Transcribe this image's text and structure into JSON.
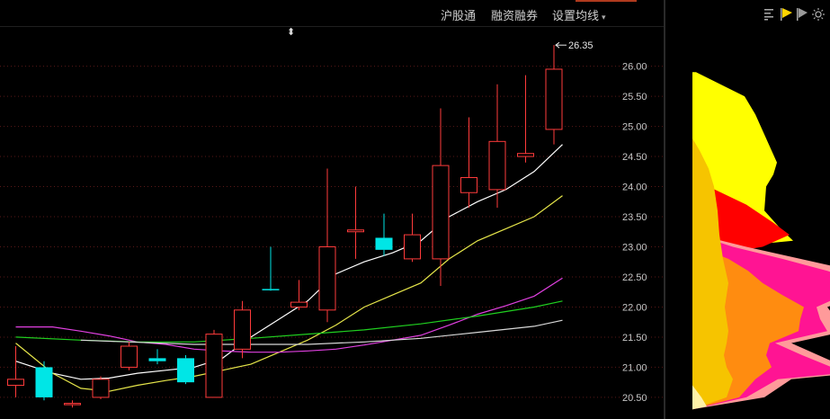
{
  "toolbar": {
    "hgt_label": "沪股通",
    "margin_label": "融资融券",
    "ma_label": "设置均线",
    "caret": "▾",
    "resize_glyph": "⬍"
  },
  "colors": {
    "up": "#ff3b3b",
    "down": "#00e6e6",
    "ma5": "#ffffff",
    "ma10": "#e6e64a",
    "ma20": "#e040e0",
    "ma30": "#20d020",
    "ma60": "#d8d8d8",
    "price_axis": "#c8c8c8",
    "grid": "#5a1818"
  },
  "chart_data": {
    "type": "candlestick",
    "max_label": "26.35",
    "ylim": [
      20.2,
      26.95
    ],
    "y_ticks": [
      "20.50",
      "21.00",
      "21.50",
      "22.00",
      "22.50",
      "23.00",
      "23.50",
      "24.00",
      "24.50",
      "25.00",
      "25.50",
      "26.00"
    ],
    "candles": [
      {
        "o": 20.7,
        "h": 21.35,
        "l": 20.5,
        "c": 20.8
      },
      {
        "o": 21.0,
        "h": 21.1,
        "l": 20.45,
        "c": 20.5
      },
      {
        "o": 20.38,
        "h": 20.45,
        "l": 20.33,
        "c": 20.4
      },
      {
        "o": 20.5,
        "h": 20.85,
        "l": 20.47,
        "c": 20.8
      },
      {
        "o": 21.0,
        "h": 21.42,
        "l": 20.95,
        "c": 21.35
      },
      {
        "o": 21.15,
        "h": 21.3,
        "l": 21.05,
        "c": 21.1
      },
      {
        "o": 21.15,
        "h": 21.2,
        "l": 20.72,
        "c": 20.75
      },
      {
        "o": 20.5,
        "h": 21.62,
        "l": 20.5,
        "c": 21.55
      },
      {
        "o": 21.3,
        "h": 22.1,
        "l": 21.15,
        "c": 21.95
      },
      {
        "o": 22.3,
        "h": 23.0,
        "l": 22.27,
        "c": 22.28
      },
      {
        "o": 22.0,
        "h": 22.45,
        "l": 21.95,
        "c": 22.08
      },
      {
        "o": 21.95,
        "h": 24.3,
        "l": 21.75,
        "c": 23.0
      },
      {
        "o": 23.25,
        "h": 24.0,
        "l": 22.8,
        "c": 23.28
      },
      {
        "o": 23.15,
        "h": 23.55,
        "l": 22.85,
        "c": 22.95
      },
      {
        "o": 22.8,
        "h": 23.55,
        "l": 22.75,
        "c": 23.2
      },
      {
        "o": 22.8,
        "h": 25.3,
        "l": 22.35,
        "c": 24.35
      },
      {
        "o": 23.9,
        "h": 25.15,
        "l": 23.65,
        "c": 24.15
      },
      {
        "o": 23.95,
        "h": 25.7,
        "l": 23.65,
        "c": 24.75
      },
      {
        "o": 24.5,
        "h": 25.85,
        "l": 24.4,
        "c": 24.55
      },
      {
        "o": 24.95,
        "h": 26.35,
        "l": 24.7,
        "c": 25.95
      }
    ],
    "ma_lines": [
      {
        "key": "ma5",
        "values": [
          [
            0,
            21.1
          ],
          [
            1.3,
            20.9
          ],
          [
            2.3,
            20.8
          ],
          [
            3.3,
            20.82
          ],
          [
            4.3,
            20.9
          ],
          [
            5.3,
            20.95
          ],
          [
            6.3,
            21.0
          ],
          [
            7.3,
            21.15
          ],
          [
            8.3,
            21.5
          ],
          [
            9.3,
            21.8
          ],
          [
            10.3,
            22.1
          ],
          [
            11.3,
            22.55
          ],
          [
            12.3,
            22.75
          ],
          [
            13.3,
            22.9
          ],
          [
            14.3,
            23.1
          ],
          [
            15.3,
            23.5
          ],
          [
            16.3,
            23.75
          ],
          [
            17.3,
            23.95
          ],
          [
            18.3,
            24.25
          ],
          [
            19.3,
            24.7
          ]
        ]
      },
      {
        "key": "ma10",
        "values": [
          [
            0,
            21.4
          ],
          [
            1.3,
            20.9
          ],
          [
            2.3,
            20.65
          ],
          [
            3.3,
            20.6
          ],
          [
            4.3,
            20.7
          ],
          [
            5.3,
            20.78
          ],
          [
            6.3,
            20.85
          ],
          [
            7.3,
            20.95
          ],
          [
            8.3,
            21.05
          ],
          [
            9.3,
            21.25
          ],
          [
            10.3,
            21.45
          ],
          [
            11.3,
            21.7
          ],
          [
            12.3,
            22.0
          ],
          [
            13.3,
            22.2
          ],
          [
            14.3,
            22.4
          ],
          [
            15.3,
            22.8
          ],
          [
            16.3,
            23.1
          ],
          [
            17.3,
            23.3
          ],
          [
            18.3,
            23.5
          ],
          [
            19.3,
            23.85
          ]
        ]
      },
      {
        "key": "ma20",
        "values": [
          [
            0,
            21.67
          ],
          [
            1.3,
            21.67
          ],
          [
            2.3,
            21.6
          ],
          [
            3.3,
            21.52
          ],
          [
            4.3,
            21.42
          ],
          [
            5.3,
            21.38
          ],
          [
            6.3,
            21.3
          ],
          [
            7.3,
            21.27
          ],
          [
            8.3,
            21.25
          ],
          [
            9.3,
            21.25
          ],
          [
            10.3,
            21.27
          ],
          [
            11.3,
            21.3
          ],
          [
            12.3,
            21.37
          ],
          [
            13.3,
            21.45
          ],
          [
            14.3,
            21.53
          ],
          [
            15.3,
            21.7
          ],
          [
            16.3,
            21.88
          ],
          [
            17.3,
            22.02
          ],
          [
            18.3,
            22.18
          ],
          [
            19.3,
            22.48
          ]
        ]
      },
      {
        "key": "ma30",
        "values": [
          [
            0,
            21.5
          ],
          [
            2.3,
            21.45
          ],
          [
            4.3,
            21.42
          ],
          [
            6.3,
            21.42
          ],
          [
            8.3,
            21.48
          ],
          [
            10.3,
            21.55
          ],
          [
            12.3,
            21.62
          ],
          [
            14.3,
            21.72
          ],
          [
            16.3,
            21.85
          ],
          [
            18.3,
            22.0
          ],
          [
            19.3,
            22.1
          ]
        ]
      },
      {
        "key": "ma60",
        "values": [
          [
            2.3,
            21.45
          ],
          [
            6.3,
            21.38
          ],
          [
            10.3,
            21.38
          ],
          [
            12.3,
            21.42
          ],
          [
            14.3,
            21.48
          ],
          [
            16.3,
            21.58
          ],
          [
            18.3,
            21.68
          ],
          [
            19.3,
            21.78
          ]
        ]
      }
    ]
  },
  "chip_profile": {
    "base": 30,
    "layers": [
      {
        "name": "chips-yellow",
        "color": "#ffff00",
        "points": [
          [
            20.3,
            0
          ],
          [
            20.5,
            22
          ],
          [
            20.8,
            32
          ],
          [
            21.2,
            28
          ],
          [
            21.6,
            30
          ],
          [
            22.0,
            32
          ],
          [
            22.5,
            35
          ],
          [
            23.0,
            42
          ],
          [
            23.1,
            112
          ],
          [
            23.3,
            98
          ],
          [
            23.6,
            80
          ],
          [
            24.0,
            82
          ],
          [
            24.2,
            90
          ],
          [
            24.4,
            94
          ],
          [
            24.8,
            82
          ],
          [
            25.2,
            70
          ],
          [
            25.5,
            58
          ],
          [
            25.9,
            4
          ]
        ]
      },
      {
        "name": "chips-red",
        "color": "#ff0000",
        "points": [
          [
            20.3,
            0
          ],
          [
            20.5,
            18
          ],
          [
            20.8,
            28
          ],
          [
            21.2,
            25
          ],
          [
            21.6,
            27
          ],
          [
            22.0,
            28
          ],
          [
            22.5,
            30
          ],
          [
            22.9,
            38
          ],
          [
            23.0,
            78
          ],
          [
            23.2,
            108
          ],
          [
            23.4,
            90
          ],
          [
            23.7,
            60
          ],
          [
            24.0,
            18
          ],
          [
            24.2,
            4
          ]
        ]
      },
      {
        "name": "chips-salmon",
        "color": "#ff9a9a",
        "points": [
          [
            20.3,
            0
          ],
          [
            20.5,
            80
          ],
          [
            20.8,
            110
          ],
          [
            20.9,
            178
          ],
          [
            21.0,
            170
          ],
          [
            21.2,
            140
          ],
          [
            21.4,
            110
          ],
          [
            21.6,
            170
          ],
          [
            21.8,
            160
          ],
          [
            22.0,
            150
          ],
          [
            22.2,
            185
          ],
          [
            22.4,
            220
          ],
          [
            22.6,
            180
          ],
          [
            22.8,
            120
          ],
          [
            23.0,
            60
          ],
          [
            23.2,
            6
          ]
        ]
      },
      {
        "name": "chips-magenta",
        "color": "#ff1493",
        "points": [
          [
            20.3,
            0
          ],
          [
            20.5,
            60
          ],
          [
            20.8,
            95
          ],
          [
            20.9,
            165
          ],
          [
            21.0,
            155
          ],
          [
            21.2,
            122
          ],
          [
            21.4,
            92
          ],
          [
            21.6,
            150
          ],
          [
            21.8,
            142
          ],
          [
            22.0,
            138
          ],
          [
            22.2,
            168
          ],
          [
            22.4,
            190
          ],
          [
            22.6,
            150
          ],
          [
            22.8,
            100
          ],
          [
            23.0,
            45
          ],
          [
            23.2,
            4
          ]
        ]
      },
      {
        "name": "chips-orange",
        "color": "#ff8c10",
        "points": [
          [
            20.3,
            0
          ],
          [
            20.5,
            52
          ],
          [
            20.8,
            70
          ],
          [
            21.0,
            88
          ],
          [
            21.2,
            82
          ],
          [
            21.4,
            86
          ],
          [
            21.6,
            118
          ],
          [
            21.8,
            120
          ],
          [
            22.0,
            124
          ],
          [
            22.2,
            100
          ],
          [
            22.4,
            78
          ],
          [
            22.6,
            62
          ],
          [
            22.8,
            40
          ],
          [
            23.0,
            6
          ]
        ]
      },
      {
        "name": "chips-gold",
        "color": "#f6c400",
        "points": [
          [
            20.3,
            0
          ],
          [
            20.5,
            38
          ],
          [
            20.8,
            45
          ],
          [
            21.0,
            38
          ],
          [
            21.2,
            35
          ],
          [
            21.4,
            38
          ],
          [
            21.6,
            40
          ],
          [
            21.8,
            38
          ],
          [
            22.0,
            36
          ],
          [
            22.4,
            40
          ],
          [
            22.8,
            34
          ],
          [
            23.2,
            30
          ],
          [
            23.6,
            28
          ],
          [
            24.0,
            24
          ],
          [
            24.3,
            18
          ],
          [
            24.6,
            8
          ],
          [
            24.8,
            0
          ]
        ]
      },
      {
        "name": "chips-cream",
        "color": "#fff2a8",
        "points": [
          [
            20.3,
            0
          ],
          [
            20.35,
            16
          ],
          [
            20.5,
            10
          ],
          [
            20.7,
            0
          ]
        ]
      }
    ]
  }
}
